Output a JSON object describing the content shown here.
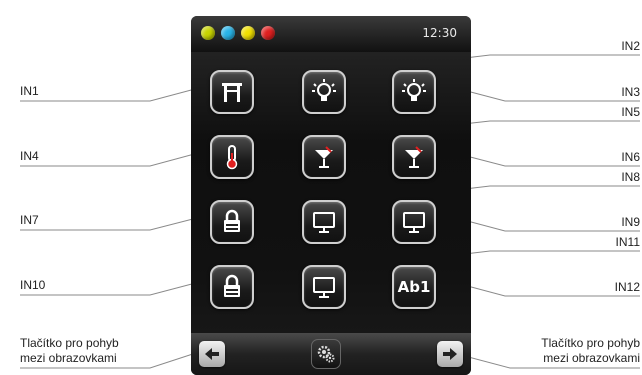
{
  "status_bar": {
    "time": "12:30",
    "dot_colors": [
      "#c8d400",
      "#28b4e8",
      "#f0e000",
      "#e02020"
    ]
  },
  "labels": {
    "in1": "IN1",
    "in2": "IN2",
    "in3": "IN3",
    "in4": "IN4",
    "in5": "IN5",
    "in6": "IN6",
    "in7": "IN7",
    "in8": "IN8",
    "in9": "IN9",
    "in10": "IN10",
    "in11": "IN11",
    "in12": "IN12",
    "nav_left_line1": "Tlačítko pro pohyb",
    "nav_left_line2": "mezi obrazovkami",
    "nav_right_line1": "Tlačítko pro pohyb",
    "nav_right_line2": "mezi obrazovkami"
  },
  "buttons": {
    "in12_text": "Ab1",
    "icons": [
      "gate-icon",
      "bulb-icon",
      "bulb-icon",
      "thermometer-icon",
      "cocktail-icon",
      "cocktail-icon",
      "lock-icon",
      "monitor-icon",
      "monitor-icon",
      "lock-icon",
      "monitor-icon",
      "text-icon"
    ]
  },
  "bottom_bar": {
    "icons": [
      "arrow-left-icon",
      "gear-icon",
      "arrow-right-icon"
    ]
  }
}
